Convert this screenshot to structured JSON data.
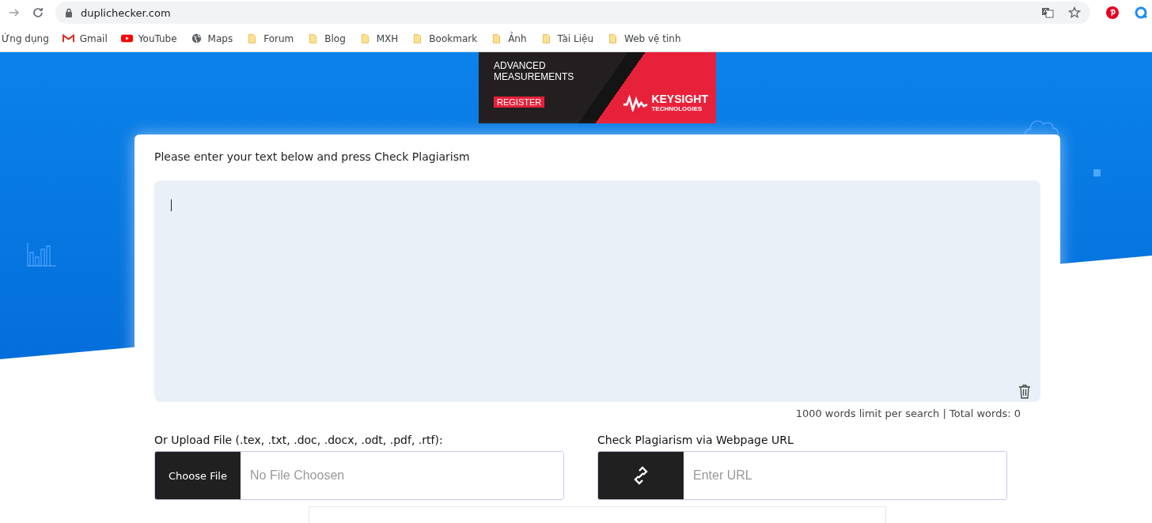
{
  "browser": {
    "url": "duplichecker.com"
  },
  "bookmarks": [
    {
      "label": "Ứng dụng",
      "kind": "apps"
    },
    {
      "label": "Gmail",
      "kind": "gmail"
    },
    {
      "label": "YouTube",
      "kind": "youtube"
    },
    {
      "label": "Maps",
      "kind": "globe"
    },
    {
      "label": "Forum",
      "kind": "folder"
    },
    {
      "label": "Blog",
      "kind": "folder"
    },
    {
      "label": "MXH",
      "kind": "folder"
    },
    {
      "label": "Bookmark",
      "kind": "folder"
    },
    {
      "label": "Ảnh",
      "kind": "folder"
    },
    {
      "label": "Tài Liệu",
      "kind": "folder"
    },
    {
      "label": "Web vệ tinh",
      "kind": "folder"
    }
  ],
  "ad": {
    "headline": "ADVANCED MEASUREMENTS",
    "button": "REGISTER",
    "brand": "KEYSIGHT",
    "brand_sub": "TECHNOLOGIES"
  },
  "checker": {
    "prompt": "Please enter your text below and press Check Plagiarism",
    "counter": "1000 words limit per search | Total words: 0",
    "upload": {
      "label": "Or Upload File (.tex, .txt, .doc, .docx, .odt, .pdf, .rtf):",
      "button": "Choose File",
      "placeholder": "No File Choosen"
    },
    "url": {
      "label": "Check Plagiarism via Webpage URL",
      "placeholder": "Enter URL"
    }
  }
}
